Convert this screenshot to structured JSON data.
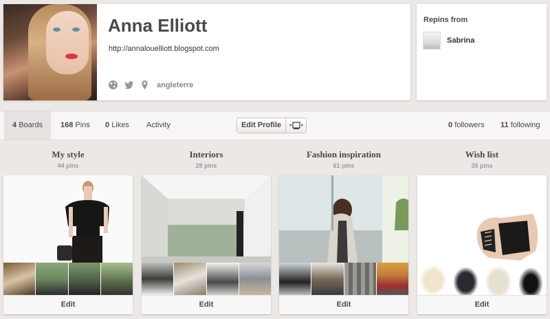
{
  "profile": {
    "name": "Anna Elliott",
    "website": "http://annalouelliott.blogspot.com",
    "location": "angleterre"
  },
  "repins": {
    "title": "Repins from",
    "users": [
      {
        "name": "Sabrina"
      }
    ]
  },
  "tabs": {
    "boards": {
      "count": "4",
      "label": "Boards"
    },
    "pins": {
      "count": "168",
      "label": "Pins"
    },
    "likes": {
      "count": "0",
      "label": "Likes"
    },
    "activity": {
      "label": "Activity"
    },
    "edit_profile_label": "Edit Profile",
    "followers": {
      "count": "0",
      "label": "followers"
    },
    "following": {
      "count": "11",
      "label": "following"
    }
  },
  "boards": [
    {
      "title": "My style",
      "pins": "44 pins",
      "edit_label": "Edit"
    },
    {
      "title": "Interiors",
      "pins": "28 pins",
      "edit_label": "Edit"
    },
    {
      "title": "Fashion inspiration",
      "pins": "61 pins",
      "edit_label": "Edit"
    },
    {
      "title": "Wish list",
      "pins": "35 pins",
      "edit_label": "Edit"
    }
  ],
  "icons": {
    "globe": "globe-icon",
    "twitter": "twitter-icon",
    "location": "location-pin-icon",
    "embed": "embed-icon"
  },
  "colors": {
    "background": "#ebe8e6",
    "text": "#4d4848",
    "muted": "#a09a9a"
  }
}
